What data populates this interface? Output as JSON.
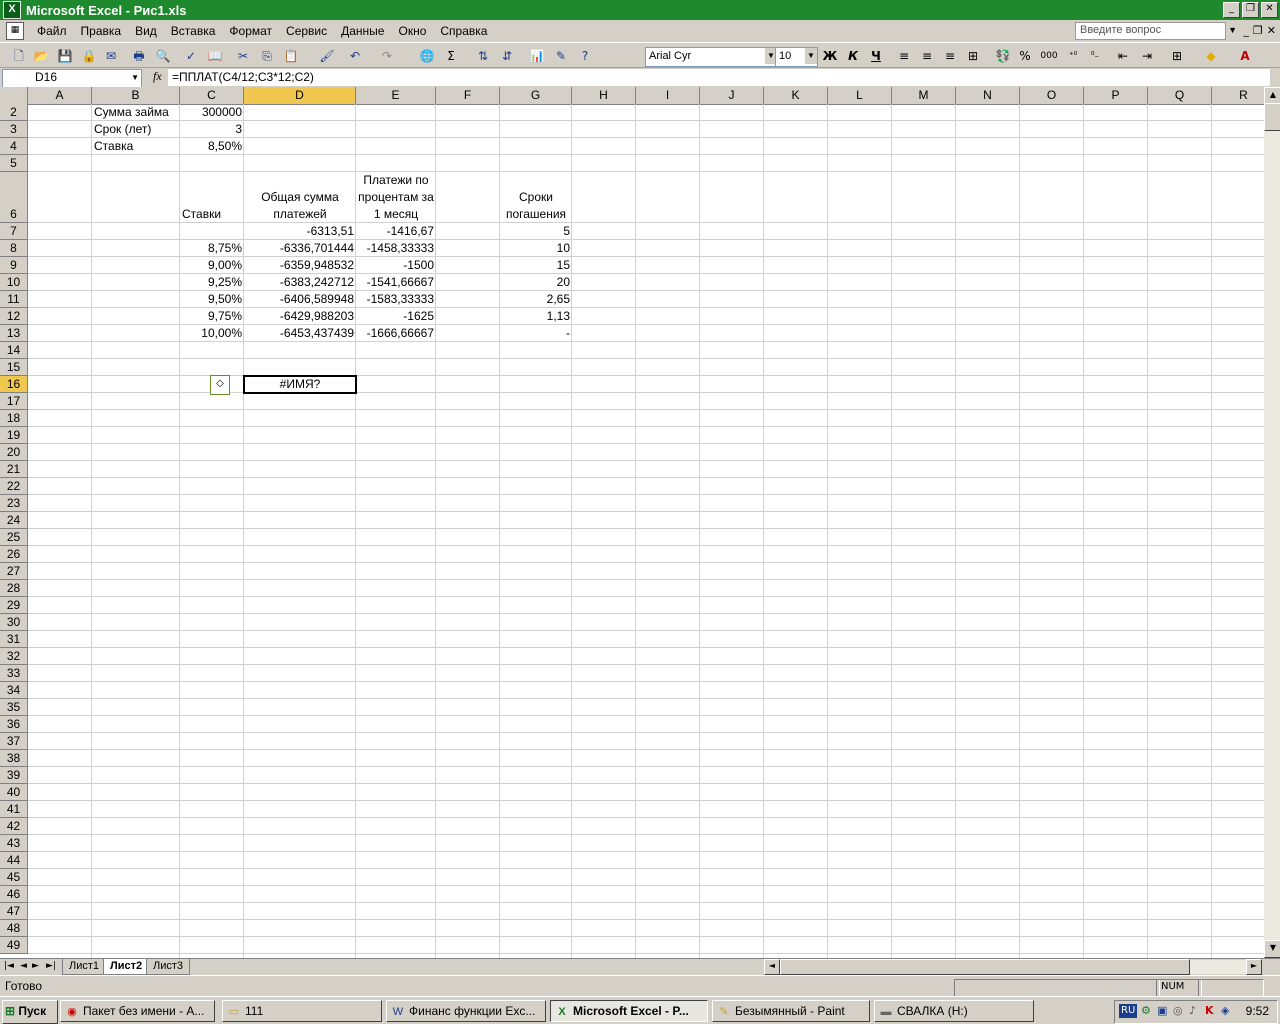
{
  "window": {
    "title": "Microsoft Excel - Рис1.xls",
    "app_icon": "excel-icon"
  },
  "menu": {
    "items": [
      "Файл",
      "Правка",
      "Вид",
      "Вставка",
      "Формат",
      "Сервис",
      "Данные",
      "Окно",
      "Справка"
    ],
    "ask_placeholder": "Введите вопрос"
  },
  "toolbar": {
    "font_name": "Arial Cyr",
    "font_size": "10",
    "bold": "Ж",
    "italic": "К",
    "underline": "Ч",
    "percent": "%",
    "thousands": "000"
  },
  "formula_bar": {
    "name_box": "D16",
    "fx": "fx",
    "formula": "=ППЛАТ(C4/12;C3*12;C2)"
  },
  "grid": {
    "columns": [
      "A",
      "B",
      "C",
      "D",
      "E",
      "F",
      "G",
      "H",
      "I",
      "J",
      "K",
      "L",
      "M",
      "N",
      "O",
      "P",
      "Q",
      "R"
    ],
    "selected_column": "D",
    "rows": [
      "2",
      "3",
      "4",
      "5",
      "6",
      "7",
      "8",
      "9",
      "10",
      "11",
      "12",
      "13",
      "14",
      "15",
      "16",
      "17",
      "18",
      "19",
      "20",
      "21",
      "22",
      "23",
      "24",
      "25",
      "26",
      "27",
      "28",
      "29",
      "30",
      "31",
      "32",
      "33",
      "34",
      "35",
      "36",
      "37",
      "38",
      "39",
      "40",
      "41",
      "42",
      "43",
      "44",
      "45",
      "46",
      "47",
      "48",
      "49"
    ],
    "selected_row": "16",
    "cells": {
      "B2": "Сумма займа",
      "C2": "300000",
      "B3": "Срок (лет)",
      "C3": "3",
      "B4": "Ставка",
      "C4": "8,50%",
      "C6": "Ставки",
      "D6": "Общая сумма платежей",
      "E6": "Платежи по процентам за 1 месяц",
      "G6": "Сроки погашения",
      "D7": "-6313,51",
      "E7": "-1416,67",
      "G7": "5",
      "C8": "8,75%",
      "D8": "-6336,701444",
      "E8": "-1458,33333",
      "G8": "10",
      "C9": "9,00%",
      "D9": "-6359,948532",
      "E9": "-1500",
      "G9": "15",
      "C10": "9,25%",
      "D10": "-6383,242712",
      "E10": "-1541,66667",
      "G10": "20",
      "C11": "9,50%",
      "D11": "-6406,589948",
      "E11": "-1583,33333",
      "G11": "2,65",
      "C12": "9,75%",
      "D12": "-6429,988203",
      "E12": "-1625",
      "G12": "1,13",
      "C13": "10,00%",
      "D13": "-6453,437439",
      "E13": "-1666,66667",
      "G13": "-",
      "D16": "#ИМЯ?"
    }
  },
  "sheets": {
    "tabs": [
      "Лист1",
      "Лист2",
      "Лист3"
    ],
    "active": "Лист2"
  },
  "status": {
    "text": "Готово",
    "num": "NUM"
  },
  "taskbar": {
    "start": "Пуск",
    "tasks": [
      "Пакет без имени - A...",
      "111",
      "Финанс функции Exc...",
      "Microsoft Excel - P...",
      "Безымянный - Paint",
      "СВАЛКА (H:)"
    ],
    "active_task": "Microsoft Excel - P...",
    "lang": "RU",
    "clock": "9:52"
  }
}
